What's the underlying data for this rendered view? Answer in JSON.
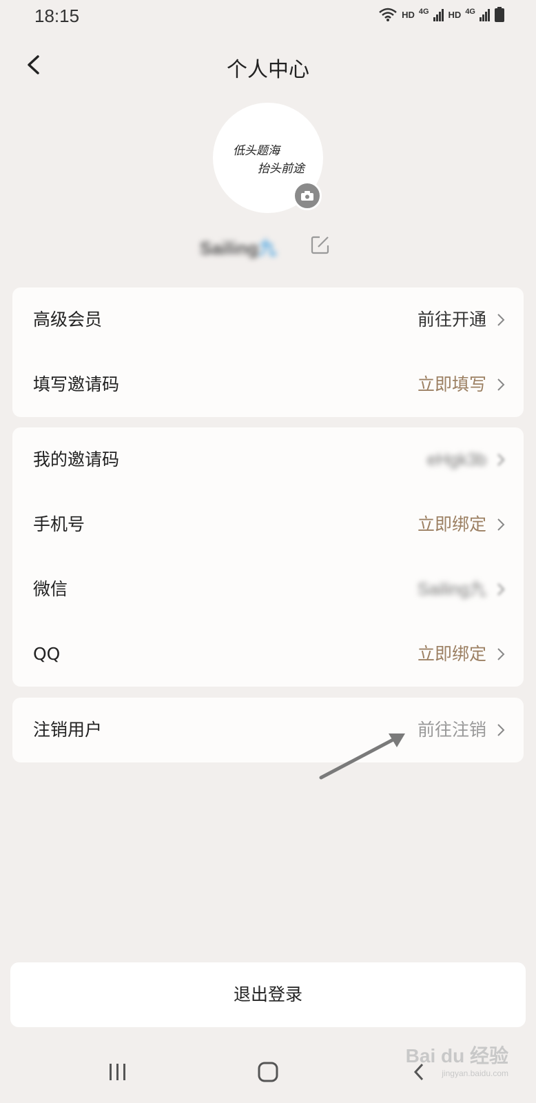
{
  "status_bar": {
    "time": "18:15",
    "hd1": "HD",
    "net1": "4G",
    "hd2": "HD",
    "net2": "4G"
  },
  "header": {
    "title": "个人中心"
  },
  "profile": {
    "avatar_text_line1": "低头题海",
    "avatar_text_line2": "抬头前途",
    "username": "Sailing",
    "username_suffix": "九"
  },
  "card1": {
    "rows": [
      {
        "label": "高级会员",
        "value": "前往开通"
      },
      {
        "label": "填写邀请码",
        "value": "立即填写"
      }
    ]
  },
  "card2": {
    "rows": [
      {
        "label": "我的邀请码",
        "value": "eHgk3b"
      },
      {
        "label": "手机号",
        "value": "立即绑定"
      },
      {
        "label": "微信",
        "value": "Sailing九"
      },
      {
        "label": "QQ",
        "value": "立即绑定"
      }
    ]
  },
  "card3": {
    "rows": [
      {
        "label": "注销用户",
        "value": "前往注销"
      }
    ]
  },
  "logout_label": "退出登录",
  "watermark": {
    "logo": "Bai du 经验",
    "sub": "jingyan.baidu.com"
  },
  "colors": {
    "background": "#f2efed",
    "card": "#fdfcfb",
    "accent_gold": "#9c8063",
    "muted": "#999999"
  }
}
